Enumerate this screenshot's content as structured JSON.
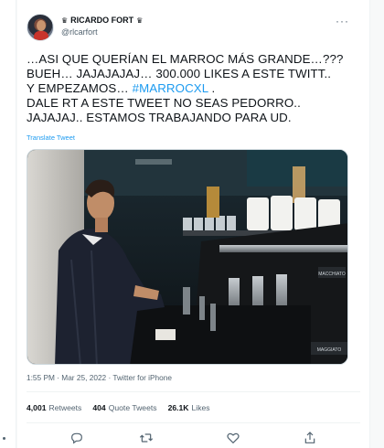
{
  "tweet": {
    "display_name": "RICARDO FORT",
    "handle": "@rlcarfort",
    "text_lines": [
      "…ASI QUE QUERÍAN EL MARROC MÁS GRANDE…???",
      "BUEH… JAJAJAJAJ… 300.000 LIKES A ESTE TWITT..",
      "Y EMPEZAMOS… ",
      "DALE RT A ESTE TWEET NO SEAS PEDORRO..",
      "JAJAJAJ.. ESTAMOS  TRABAJANDO PARA UD."
    ],
    "hashtag": "#MARROCXL",
    "hashtag_suffix": " .",
    "translate_label": "Translate Tweet",
    "time": "1:55 PM",
    "date": "Mar 25, 2022",
    "source": "Twitter for iPhone",
    "separator": " · "
  },
  "stats": {
    "retweets_count": "4,001",
    "retweets_label": "Retweets",
    "quotes_count": "404",
    "quotes_label": "Quote Tweets",
    "likes_count": "26.1K",
    "likes_label": "Likes"
  },
  "media": {
    "machine_brand": "MACCHIATO",
    "machine_brand_2": "MAGGIATO"
  },
  "icons": {
    "more": "more-icon",
    "reply": "reply-icon",
    "retweet": "retweet-icon",
    "like": "heart-icon",
    "share": "share-icon"
  },
  "colors": {
    "accent": "#1d9bf0",
    "text": "#0f1419",
    "secondary": "#536471"
  }
}
